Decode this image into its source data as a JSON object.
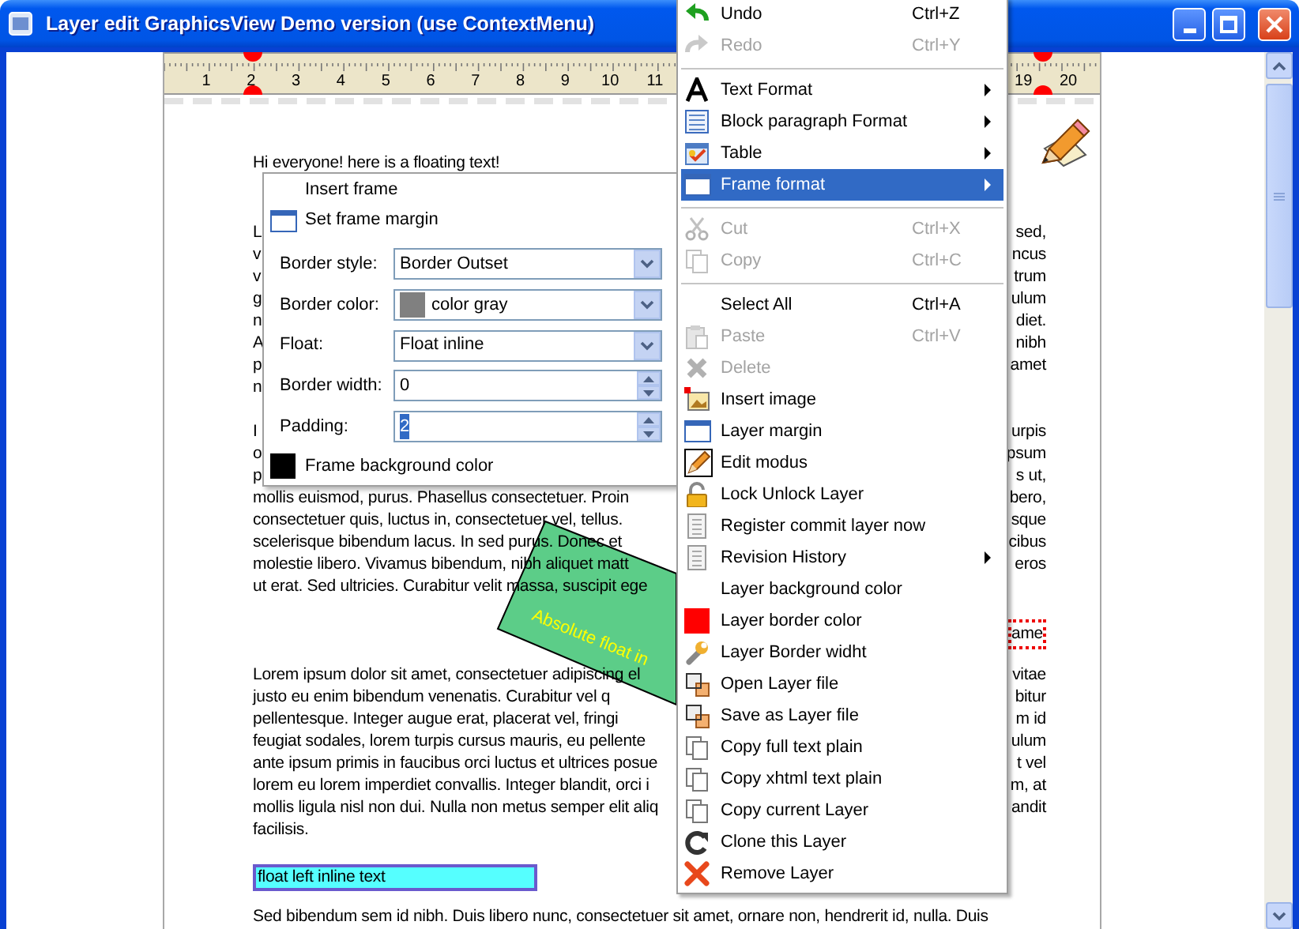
{
  "window": {
    "title": "Layer edit GraphicsView Demo version (use ContextMenu)"
  },
  "ruler": {
    "left_numbers": [
      "1",
      "2",
      "3",
      "4",
      "5",
      "6",
      "7",
      "8",
      "9",
      "10",
      "11"
    ],
    "right_numbers": [
      "19",
      "20"
    ]
  },
  "document": {
    "blocks": [
      {
        "kind": "heading",
        "text": "Hi everyone! here is a floating text!"
      },
      {
        "kind": "paragraph",
        "lines": [
          {
            "left": "L",
            "right": "sed,"
          },
          {
            "left": "v",
            "right": "ncus"
          },
          {
            "left": "v",
            "right": "trum"
          },
          {
            "left": "g",
            "right": "ulum"
          },
          {
            "left": "n",
            "right": "diet."
          },
          {
            "left": "A",
            "right": "nibh"
          },
          {
            "left": "p",
            "right": "amet"
          },
          {
            "left": "n"
          }
        ]
      },
      {
        "kind": "paragraph",
        "lines": [
          {
            "left": "I",
            "right": "urpis"
          },
          {
            "left": "o",
            "right": "psum"
          },
          {
            "left": "p",
            "right": "s ut,"
          },
          {
            "left": "mollis euismod, purus. Phasellus consectetuer. Proin",
            "right": "bero,"
          },
          {
            "left": "consectetuer quis, luctus in, consectetuer vel, tellus.",
            "right": "sque"
          },
          {
            "left": "scelerisque bibendum lacus. In sed purus. Donec et",
            "right": "cibus"
          },
          {
            "left": "molestie libero. Vivamus bibendum, nibh aliquet matt",
            "right": "eros"
          },
          {
            "left": "ut erat. Sed ultricies. Curabitur velit massa, suscipit ege"
          }
        ]
      },
      {
        "kind": "frame",
        "text": "ame"
      },
      {
        "kind": "paragraph",
        "lines": [
          {
            "left": "Lorem ipsum dolor sit amet, consectetuer adipiscing el",
            "right": "vitae"
          },
          {
            "left": "justo eu enim bibendum venenatis. Curabitur vel q",
            "right": "bitur"
          },
          {
            "left": "pellentesque. Integer augue erat, placerat vel, fringi",
            "right": "m id"
          },
          {
            "left": "feugiat sodales, lorem turpis cursus mauris, eu pellente",
            "right": "ulum"
          },
          {
            "left": "ante ipsum primis in faucibus orci luctus et ultrices posue",
            "right": "t vel"
          },
          {
            "left": "lorem eu lorem imperdiet convallis. Integer blandit, orci i",
            "right": "m, at"
          },
          {
            "left": "mollis ligula nisl non dui. Nulla non metus semper elit aliq",
            "right": "andit"
          },
          {
            "left": "facilisis."
          }
        ]
      },
      {
        "kind": "float_box",
        "text": "float left inline text"
      },
      {
        "kind": "line",
        "text": "Sed bibendum sem id nibh. Duis libero nunc, consectetuer sit amet, ornare non, hendrerit id, nulla. Duis"
      }
    ]
  },
  "floating_shape": {
    "text": "Absolute float in"
  },
  "frame_menu": {
    "items": [
      {
        "label": "Insert frame"
      },
      {
        "label": "Set frame margin"
      }
    ],
    "fields": [
      {
        "kind": "select",
        "label": "Border style:",
        "value": "Border Outset",
        "selected": false
      },
      {
        "kind": "select",
        "label": "Border color:",
        "value": "color gray",
        "color": "#808080",
        "selected": false
      },
      {
        "kind": "select",
        "label": "Float:",
        "value": "Float inline",
        "selected": false
      },
      {
        "kind": "spin",
        "label": "Border width:",
        "value": "0",
        "selected": false
      },
      {
        "kind": "spin",
        "label": "Padding:",
        "value": "2",
        "selected": true
      }
    ],
    "background_item": {
      "label": "Frame background color",
      "color": "#000000"
    }
  },
  "context_menu": {
    "items": [
      {
        "kind": "item",
        "label": "Undo",
        "shortcut": "Ctrl+Z",
        "disabled": false,
        "selected": false,
        "submenu": false
      },
      {
        "kind": "item",
        "label": "Redo",
        "shortcut": "Ctrl+Y",
        "disabled": true,
        "selected": false,
        "submenu": false
      },
      {
        "kind": "separator"
      },
      {
        "kind": "item",
        "label": "Text Format",
        "disabled": false,
        "selected": false,
        "submenu": true
      },
      {
        "kind": "item",
        "label": "Block paragraph Format",
        "disabled": false,
        "selected": false,
        "submenu": true
      },
      {
        "kind": "item",
        "label": "Table",
        "disabled": false,
        "selected": false,
        "submenu": true
      },
      {
        "kind": "item",
        "label": "Frame format",
        "disabled": false,
        "selected": true,
        "submenu": true
      },
      {
        "kind": "separator"
      },
      {
        "kind": "item",
        "label": "Cut",
        "shortcut": "Ctrl+X",
        "disabled": true,
        "selected": false,
        "submenu": false
      },
      {
        "kind": "item",
        "label": "Copy",
        "shortcut": "Ctrl+C",
        "disabled": true,
        "selected": false,
        "submenu": false
      },
      {
        "kind": "separator"
      },
      {
        "kind": "item",
        "label": "Select All",
        "shortcut": "Ctrl+A",
        "disabled": false,
        "selected": false,
        "submenu": false
      },
      {
        "kind": "item",
        "label": "Paste",
        "shortcut": "Ctrl+V",
        "disabled": true,
        "selected": false,
        "submenu": false
      },
      {
        "kind": "item",
        "label": "Delete",
        "disabled": true,
        "selected": false,
        "submenu": false
      },
      {
        "kind": "item",
        "label": "Insert image",
        "disabled": false,
        "selected": false,
        "submenu": false
      },
      {
        "kind": "item",
        "label": "Layer margin",
        "disabled": false,
        "selected": false,
        "submenu": false
      },
      {
        "kind": "item",
        "label": "Edit modus",
        "disabled": false,
        "selected": false,
        "submenu": false
      },
      {
        "kind": "item",
        "label": "Lock Unlock Layer",
        "disabled": false,
        "selected": false,
        "submenu": false
      },
      {
        "kind": "item",
        "label": "Register commit layer now",
        "disabled": false,
        "selected": false,
        "submenu": false
      },
      {
        "kind": "item",
        "label": "Revision History",
        "disabled": false,
        "selected": false,
        "submenu": true
      },
      {
        "kind": "item",
        "label": "Layer background color",
        "disabled": false,
        "selected": false,
        "submenu": false
      },
      {
        "kind": "item",
        "label": "Layer border color",
        "color": "#ff0000",
        "disabled": false,
        "selected": false,
        "submenu": false
      },
      {
        "kind": "item",
        "label": "Layer Border widht",
        "disabled": false,
        "selected": false,
        "submenu": false
      },
      {
        "kind": "item",
        "label": "Open Layer file",
        "disabled": false,
        "selected": false,
        "submenu": false
      },
      {
        "kind": "item",
        "label": "Save as Layer file",
        "disabled": false,
        "selected": false,
        "submenu": false
      },
      {
        "kind": "item",
        "label": "Copy full text plain",
        "disabled": false,
        "selected": false,
        "submenu": false
      },
      {
        "kind": "item",
        "label": "Copy xhtml text plain",
        "disabled": false,
        "selected": false,
        "submenu": false
      },
      {
        "kind": "item",
        "label": "Copy current Layer",
        "disabled": false,
        "selected": false,
        "submenu": false
      },
      {
        "kind": "item",
        "label": "Clone this Layer",
        "disabled": false,
        "selected": false,
        "submenu": false
      },
      {
        "kind": "item",
        "label": "Remove Layer",
        "disabled": false,
        "selected": false,
        "submenu": false
      }
    ]
  }
}
